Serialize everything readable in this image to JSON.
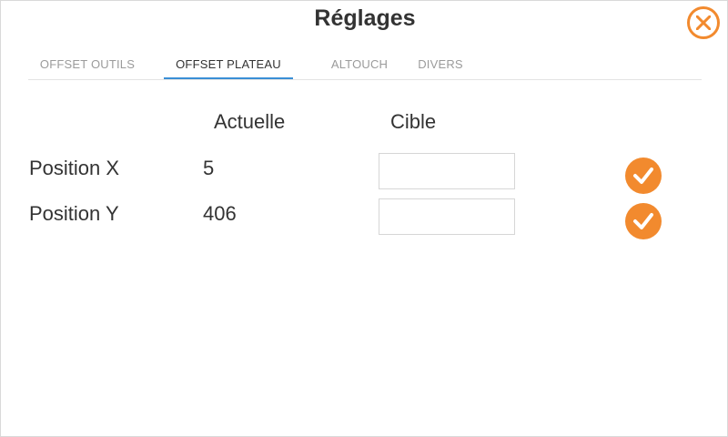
{
  "window": {
    "title": "Réglages"
  },
  "close_button": {
    "icon": "close-icon",
    "color": "#f28a2e"
  },
  "tabs": [
    {
      "label": "OFFSET OUTILS",
      "active": false
    },
    {
      "label": "OFFSET PLATEAU",
      "active": true
    },
    {
      "label": "ALTOUCH",
      "active": false
    },
    {
      "label": "DIVERS",
      "active": false
    }
  ],
  "table": {
    "headers": {
      "current": "Actuelle",
      "target": "Cible"
    },
    "rows": [
      {
        "label": "Position X",
        "current": "5",
        "target_value": "",
        "confirm_icon": "check-icon"
      },
      {
        "label": "Position Y",
        "current": "406",
        "target_value": "",
        "confirm_icon": "check-icon"
      }
    ]
  },
  "colors": {
    "accent": "#f28a2e",
    "tab_indicator": "#3a8fd6",
    "text": "#333333",
    "tab_inactive": "#9b9b9b"
  }
}
